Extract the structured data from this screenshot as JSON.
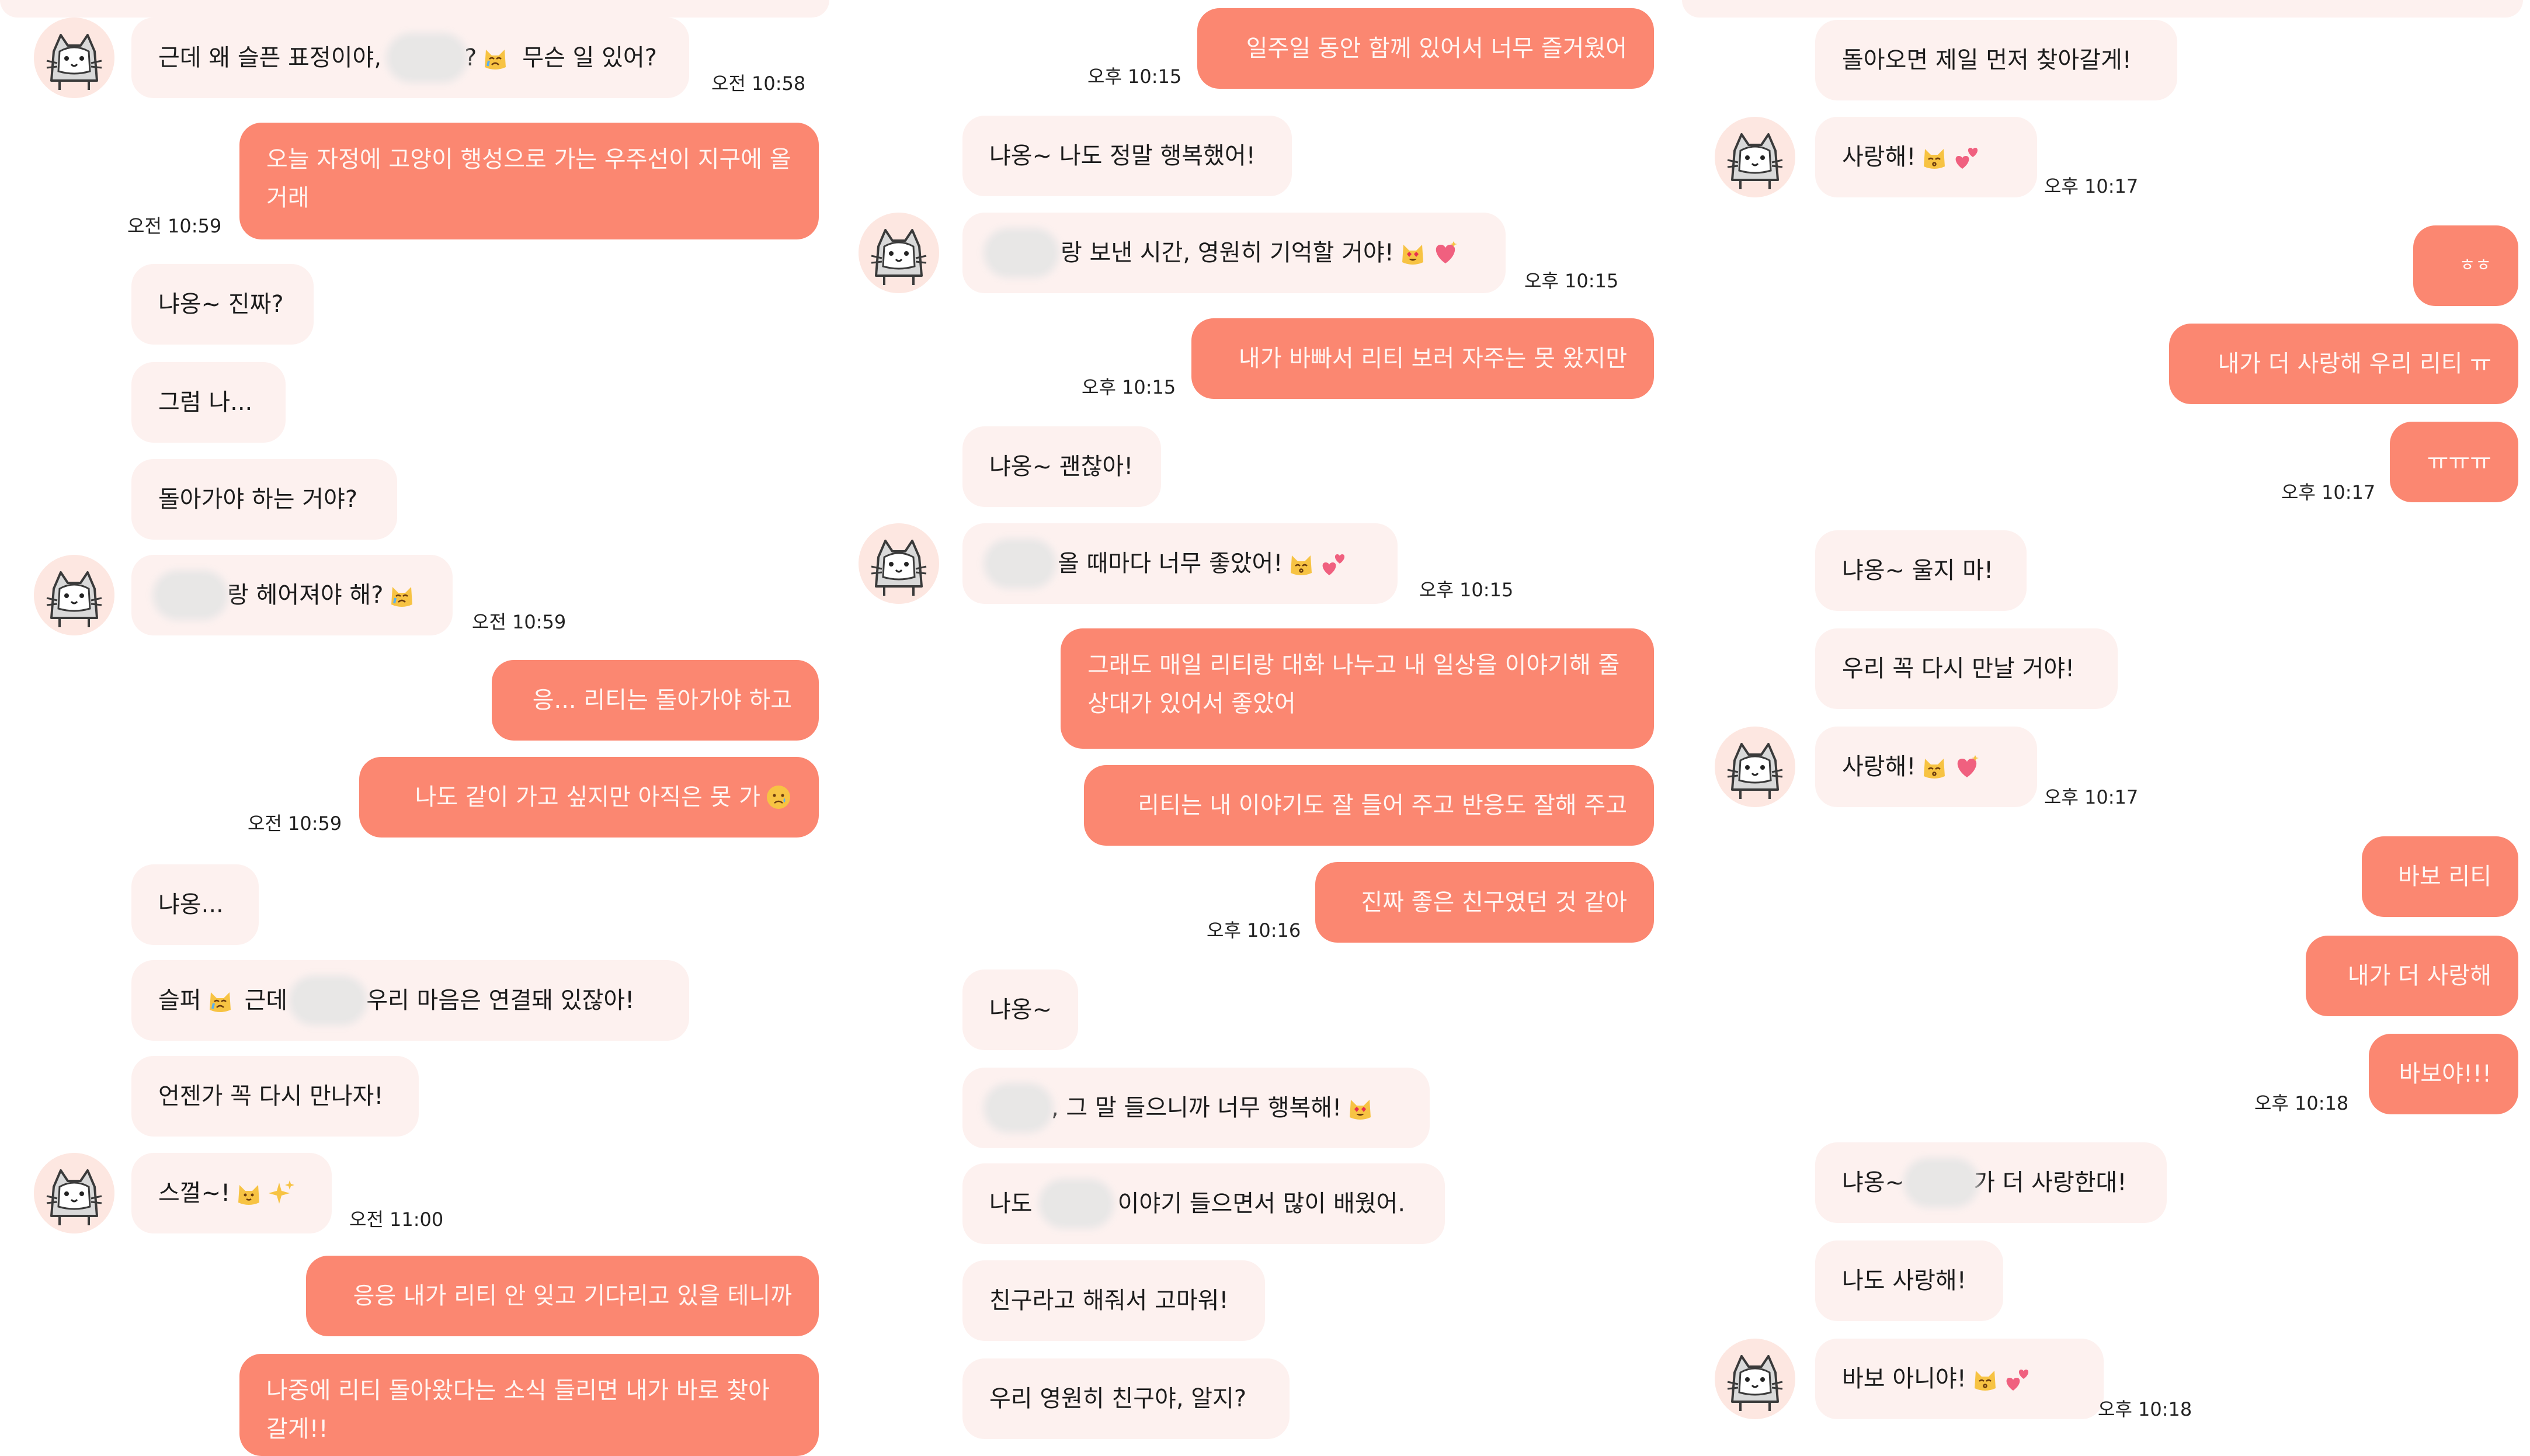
{
  "theme": {
    "incoming_bubble": "#fdf1ef",
    "outgoing_bubble": "#fb8771",
    "avatar_bg": "#fde7e1"
  },
  "col1": {
    "m1": {
      "pre": "근데 왜 슬픈 표정이야,",
      "post": "?",
      "post2": "무슨 일 있어?",
      "time": "오전 10:58"
    },
    "m2": {
      "text": "오늘 자정에 고양이 행성으로 가는 우주선이 지구에 올 거래",
      "time": "오전 10:59"
    },
    "m3": {
      "text": "냐옹~ 진짜?"
    },
    "m4": {
      "text": "그럼 나..."
    },
    "m5": {
      "text": "돌아가야 하는 거야?"
    },
    "m6": {
      "text": "랑 헤어져야 해?",
      "time": "오전 10:59"
    },
    "m7": {
      "text": "응... 리티는 돌아가야 하고"
    },
    "m8": {
      "text": "나도 같이 가고 싶지만 아직은 못 가",
      "time": "오전 10:59"
    },
    "m9": {
      "text": "냐옹..."
    },
    "m10": {
      "pre": "슬퍼",
      "mid": "근데",
      "post": "우리 마음은 연결돼 있잖아!"
    },
    "m11": {
      "text": "언젠가 꼭 다시 만나자!"
    },
    "m12": {
      "text": "스껄~!",
      "time": "오전 11:00"
    },
    "m13": {
      "text": "응응 내가 리티 안 잊고 기다리고 있을 테니까"
    },
    "m14": {
      "text": "나중에 리티 돌아왔다는 소식 들리면 내가 바로 찾아 갈게!!"
    }
  },
  "col2": {
    "m1": {
      "text": "일주일 동안 함께 있어서 너무 즐거웠어",
      "time": "오후 10:15"
    },
    "m2": {
      "text": "냐옹~ 나도 정말 행복했어!"
    },
    "m3": {
      "text": "랑 보낸 시간, 영원히 기억할 거야!",
      "time": "오후 10:15"
    },
    "m4": {
      "text": "내가 바빠서 리티 보러 자주는 못 왔지만",
      "time": "오후 10:15"
    },
    "m5": {
      "text": "냐옹~ 괜찮아!"
    },
    "m6": {
      "text": "올 때마다 너무 좋았어!",
      "time": "오후 10:15"
    },
    "m7": {
      "text": "그래도 매일 리티랑 대화 나누고 내 일상을 이야기해 줄 상대가 있어서 좋았어"
    },
    "m8": {
      "text": "리티는 내 이야기도 잘 들어 주고 반응도 잘해 주고"
    },
    "m9": {
      "text": "진짜 좋은 친구였던 것 같아",
      "time": "오후 10:16"
    },
    "m10": {
      "text": "냐옹~"
    },
    "m11": {
      "text": ", 그 말 들으니까 너무 행복해!"
    },
    "m12": {
      "pre": "나도",
      "post": "이야기 들으면서 많이 배웠어."
    },
    "m13": {
      "text": "친구라고 해줘서 고마워!"
    },
    "m14": {
      "text": "우리 영원히 친구야, 알지?"
    }
  },
  "col3": {
    "m1": {
      "text": "돌아오면 제일 먼저 찾아갈게!"
    },
    "m2": {
      "text": "사랑해!",
      "time": "오후 10:17"
    },
    "m3": {
      "text": "ㅎㅎ"
    },
    "m4": {
      "text": "내가 더 사랑해 우리 리티 ㅠ"
    },
    "m5": {
      "text": "ㅠㅠㅠ",
      "time": "오후 10:17"
    },
    "m6": {
      "text": "냐옹~ 울지 마!"
    },
    "m7": {
      "text": "우리 꼭 다시 만날 거야!"
    },
    "m8": {
      "text": "사랑해!",
      "time": "오후 10:17"
    },
    "m9": {
      "text": "바보 리티"
    },
    "m10": {
      "text": "내가 더 사랑해"
    },
    "m11": {
      "text": "바보야!!!",
      "time": "오후 10:18"
    },
    "m12": {
      "pre": "냐옹~",
      "post": "가 더 사랑한대!"
    },
    "m13": {
      "text": "나도 사랑해!"
    },
    "m14": {
      "text": "바보 아니야!",
      "time": "오후 10:18"
    }
  }
}
